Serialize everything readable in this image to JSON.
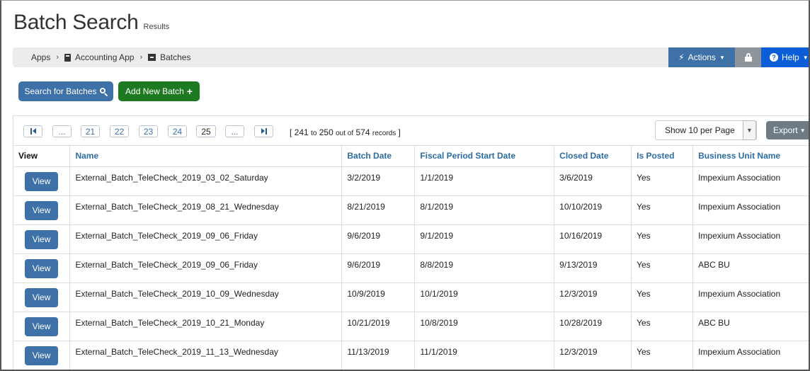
{
  "page": {
    "title": "Batch Search",
    "subtitle": "Results"
  },
  "breadcrumb": {
    "items": [
      {
        "label": "Apps",
        "icon": "grid-icon"
      },
      {
        "label": "Accounting App",
        "icon": "book-icon"
      },
      {
        "label": "Batches",
        "icon": "archive-icon"
      }
    ],
    "separator": "›"
  },
  "toolbar": {
    "actions_label": "Actions",
    "help_label": "Help"
  },
  "buttons": {
    "search_label": "Search for Batches",
    "add_label": "Add New Batch"
  },
  "pager": {
    "ellipsis": "...",
    "pages": [
      "21",
      "22",
      "23",
      "24",
      "25"
    ],
    "current": "25",
    "records_open": "[ ",
    "range_start": "241",
    "to_label": "to",
    "range_end": "250",
    "out_of_label": "out of",
    "total": "574",
    "records_label": "records",
    "records_close": " ]"
  },
  "per_page": {
    "selected": "Show 10 per Page"
  },
  "export_label": "Export",
  "table": {
    "columns": [
      "View",
      "Name",
      "Batch Date",
      "Fiscal Period Start Date",
      "Closed Date",
      "Is Posted",
      "Business Unit Name"
    ],
    "view_button_label": "View",
    "rows": [
      [
        "External_Batch_TeleCheck_2019_03_02_Saturday",
        "3/2/2019",
        "1/1/2019",
        "3/6/2019",
        "Yes",
        "Impexium Association"
      ],
      [
        "External_Batch_TeleCheck_2019_08_21_Wednesday",
        "8/21/2019",
        "8/1/2019",
        "10/10/2019",
        "Yes",
        "Impexium Association"
      ],
      [
        "External_Batch_TeleCheck_2019_09_06_Friday",
        "9/6/2019",
        "9/1/2019",
        "10/16/2019",
        "Yes",
        "Impexium Association"
      ],
      [
        "External_Batch_TeleCheck_2019_09_06_Friday",
        "9/6/2019",
        "8/8/2019",
        "9/13/2019",
        "Yes",
        "ABC BU"
      ],
      [
        "External_Batch_TeleCheck_2019_10_09_Wednesday",
        "10/9/2019",
        "10/1/2019",
        "12/3/2019",
        "Yes",
        "Impexium Association"
      ],
      [
        "External_Batch_TeleCheck_2019_10_21_Monday",
        "10/21/2019",
        "10/8/2019",
        "10/28/2019",
        "Yes",
        "ABC BU"
      ],
      [
        "External_Batch_TeleCheck_2019_11_13_Wednesday",
        "11/13/2019",
        "11/1/2019",
        "12/3/2019",
        "Yes",
        "Impexium Association"
      ]
    ]
  },
  "colors": {
    "primary": "#3e71a8",
    "success": "#1e7a21",
    "help": "#0b5ed7",
    "lock": "#8d949a",
    "header_text": "#2b6ca3"
  }
}
